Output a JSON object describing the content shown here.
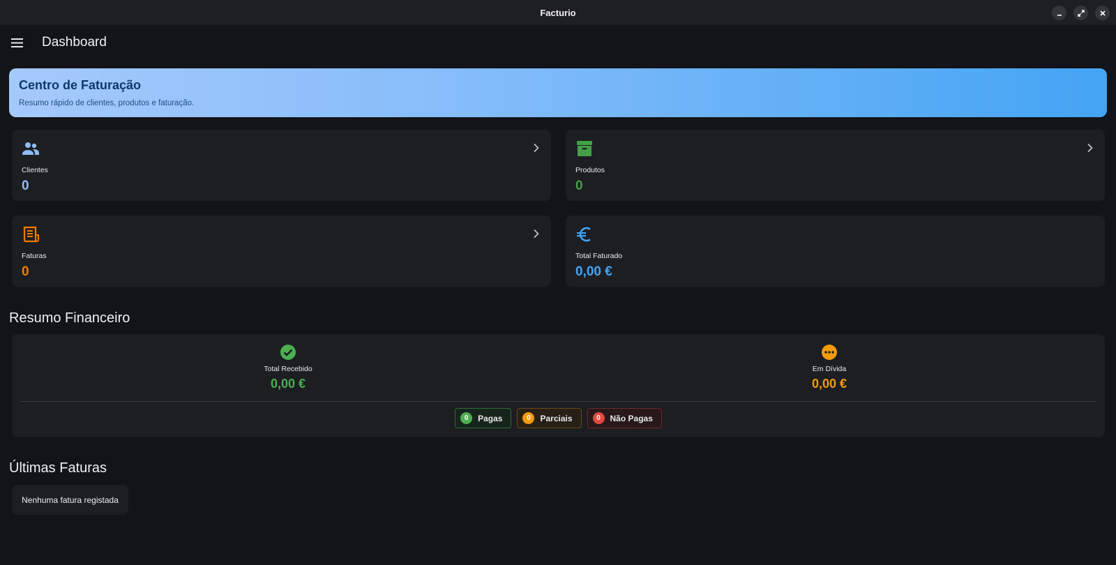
{
  "window": {
    "title": "Facturio"
  },
  "appbar": {
    "title": "Dashboard"
  },
  "hero": {
    "title": "Centro de Faturação",
    "subtitle": "Resumo rápido de clientes, produtos e faturação."
  },
  "stats": [
    {
      "label": "Clientes",
      "value": "0",
      "icon": "people-icon",
      "color": "#8fbcf5"
    },
    {
      "label": "Produtos",
      "value": "0",
      "icon": "archive-icon",
      "color": "#43a047"
    },
    {
      "label": "Faturas",
      "value": "0",
      "icon": "receipt-icon",
      "color": "#f57c00"
    },
    {
      "label": "Total Faturado",
      "value": "0,00 €",
      "icon": "euro-icon",
      "color": "#42a5f5"
    }
  ],
  "financial": {
    "section_title": "Resumo Financeiro",
    "received": {
      "label": "Total Recebido",
      "value": "0,00 €",
      "color": "#4caf50"
    },
    "debt": {
      "label": "Em Dívida",
      "value": "0,00 €",
      "color": "#f59a0c"
    },
    "chips": [
      {
        "count": "0",
        "label": "Pagas"
      },
      {
        "count": "0",
        "label": "Parciais"
      },
      {
        "count": "0",
        "label": "Não Pagas"
      }
    ]
  },
  "latest": {
    "section_title": "Últimas Faturas",
    "empty_text": "Nenhuma fatura registada"
  }
}
